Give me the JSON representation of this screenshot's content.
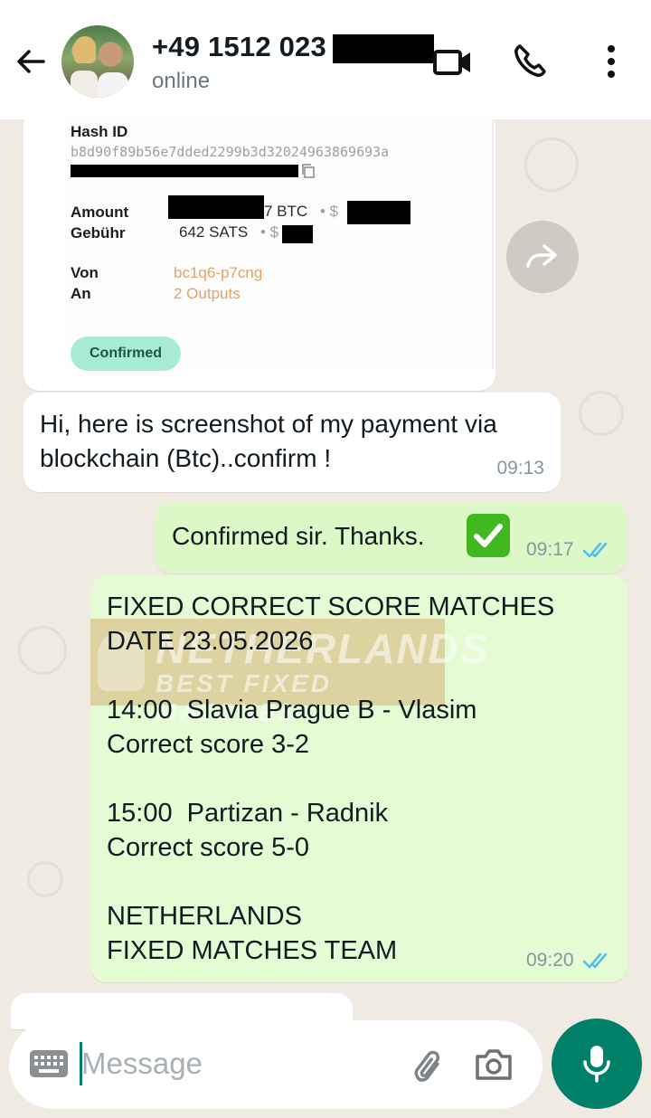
{
  "header": {
    "contact_name": "+49 1512 023",
    "status": "online"
  },
  "image_message": {
    "hash_label": "Hash ID",
    "hash_value": "b8d90f89b56e7dded2299b3d32024963869693a",
    "amount_label": "Amount",
    "amount_unit": "7 BTC",
    "amount_fiat_prefix": "• $",
    "fee_label": "Gebühr",
    "fee_value": "642 SATS",
    "fee_fiat_prefix": "• $",
    "from_label": "Von",
    "from_value": "bc1q6-p7cng",
    "to_label": "An",
    "to_value": "2 Outputs",
    "status_pill": "Confirmed"
  },
  "messages": [
    {
      "direction": "in",
      "text": "Hi, here is screenshot of my payment via blockchain (Btc)..confirm !",
      "time": "09:13"
    },
    {
      "direction": "out",
      "text": "Confirmed sir. Thanks.",
      "emoji": "check-mark-button-emoji",
      "time": "09:17",
      "status": "read"
    },
    {
      "direction": "in",
      "text": "FIXED CORRECT SCORE MATCHES\nDATE 23.05.2026\n\n14:00  Slavia Prague B - Vlasim\nCorrect score 3-2\n\n15:00  Partizan - Radnik\nCorrect score 5-0\n\nNETHERLANDS\nFIXED MATCHES TEAM",
      "time": "09:20",
      "status": "read"
    }
  ],
  "watermark": {
    "line1": "NETHERLANDS",
    "line2": "BEST FIXED MATCHES"
  },
  "composer": {
    "placeholder": "Message"
  },
  "colors": {
    "accent": "#008069",
    "read_ticks": "#53bdeb",
    "outgoing_bubble": "#dcf8c6",
    "chat_background": "#efeae2"
  }
}
